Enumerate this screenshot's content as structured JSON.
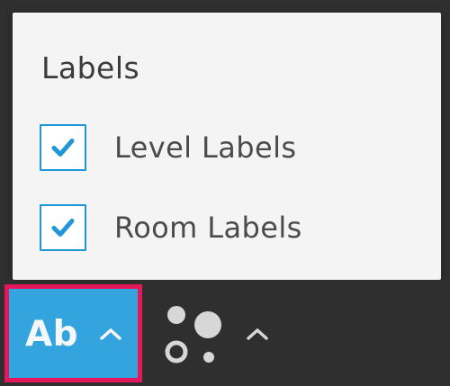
{
  "popup": {
    "title": "Labels",
    "options": [
      {
        "label": "Level Labels",
        "checked": true
      },
      {
        "label": "Room Labels",
        "checked": true
      }
    ]
  },
  "toolbar": {
    "labels_button_text": "Ab"
  },
  "icons": {
    "checkmark": "checkmark-icon",
    "chevron_up": "chevron-up-icon",
    "style": "circles-style-icon"
  },
  "colors": {
    "panel_background": "#f4f4f4",
    "toolbar_background": "#2f2f2f",
    "accent_blue": "#34a4de",
    "checkbox_blue": "#1e96d7",
    "highlight_red": "#e4175b",
    "text_dark": "#4b4b4b"
  }
}
